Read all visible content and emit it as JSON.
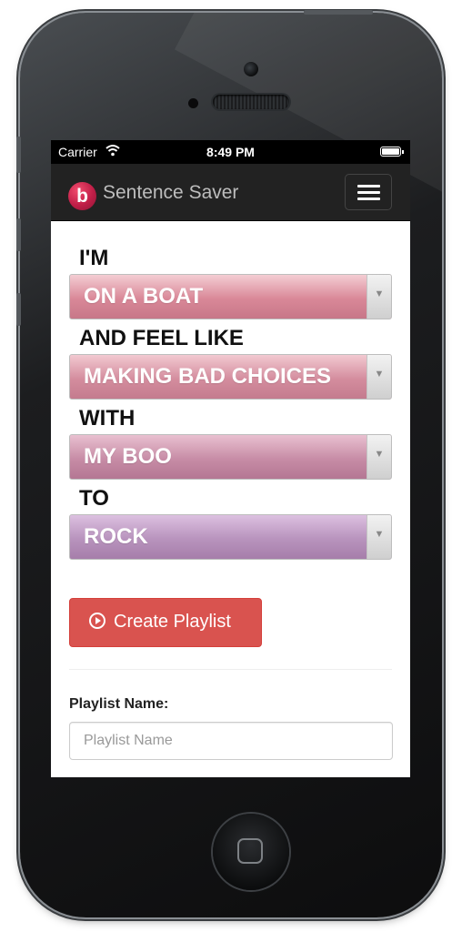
{
  "status_bar": {
    "carrier": "Carrier",
    "time": "8:49 PM",
    "icons": [
      "wifi-icon",
      "battery-icon"
    ]
  },
  "navbar": {
    "logo_letter": "b",
    "brand": "Sentence Saver",
    "menu_icon": "hamburger-icon"
  },
  "sentence": [
    {
      "label": "I'M",
      "value": "ON A BOAT"
    },
    {
      "label": "AND FEEL LIKE",
      "value": "MAKING BAD CHOICES"
    },
    {
      "label": "WITH",
      "value": "MY BOO"
    },
    {
      "label": "TO",
      "value": "ROCK"
    }
  ],
  "create_button": {
    "label": "Create Playlist",
    "icon": "play-circle-icon"
  },
  "playlist_form": {
    "label": "Playlist Name:",
    "placeholder": "Playlist Name",
    "value": ""
  },
  "colors": {
    "navbar": "#222222",
    "create_button": "#d9534f",
    "logo": "#d6224f"
  }
}
